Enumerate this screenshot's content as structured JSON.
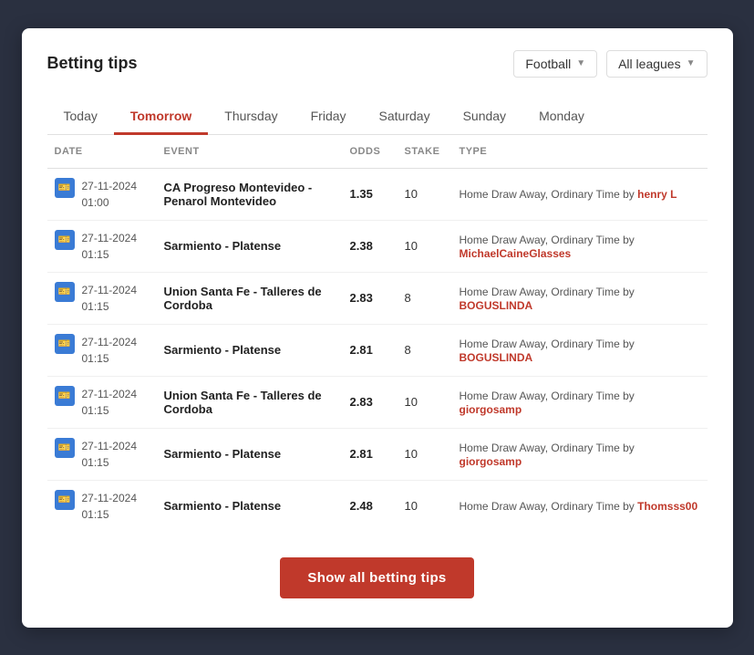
{
  "header": {
    "title": "Betting tips"
  },
  "controls": {
    "football_label": "Football",
    "leagues_label": "All leagues"
  },
  "tabs": [
    {
      "id": "today",
      "label": "Today",
      "active": false
    },
    {
      "id": "tomorrow",
      "label": "Tomorrow",
      "active": true
    },
    {
      "id": "thursday",
      "label": "Thursday",
      "active": false
    },
    {
      "id": "friday",
      "label": "Friday",
      "active": false
    },
    {
      "id": "saturday",
      "label": "Saturday",
      "active": false
    },
    {
      "id": "sunday",
      "label": "Sunday",
      "active": false
    },
    {
      "id": "monday",
      "label": "Monday",
      "active": false
    }
  ],
  "table": {
    "columns": [
      "DATE",
      "EVENT",
      "ODDS",
      "STAKE",
      "TYPE"
    ],
    "rows": [
      {
        "date": "27-11-2024",
        "time": "01:00",
        "event": "CA Progreso Montevideo - Penarol Montevideo",
        "odds": "1.35",
        "stake": "10",
        "type_text": "Home Draw Away, Ordinary Time by ",
        "user": "henry L",
        "user_color": "#c0392b"
      },
      {
        "date": "27-11-2024",
        "time": "01:15",
        "event": "Sarmiento - Platense",
        "odds": "2.38",
        "stake": "10",
        "type_text": "Home Draw Away, Ordinary Time by ",
        "user": "MichaelCaineGlasses",
        "user_color": "#c0392b"
      },
      {
        "date": "27-11-2024",
        "time": "01:15",
        "event": "Union Santa Fe - Talleres de Cordoba",
        "odds": "2.83",
        "stake": "8",
        "type_text": "Home Draw Away, Ordinary Time by ",
        "user": "BOGUSLINDA",
        "user_color": "#c0392b"
      },
      {
        "date": "27-11-2024",
        "time": "01:15",
        "event": "Sarmiento - Platense",
        "odds": "2.81",
        "stake": "8",
        "type_text": "Home Draw Away, Ordinary Time by ",
        "user": "BOGUSLINDA",
        "user_color": "#c0392b"
      },
      {
        "date": "27-11-2024",
        "time": "01:15",
        "event": "Union Santa Fe - Talleres de Cordoba",
        "odds": "2.83",
        "stake": "10",
        "type_text": "Home Draw Away, Ordinary Time by ",
        "user": "giorgosamp",
        "user_color": "#c0392b"
      },
      {
        "date": "27-11-2024",
        "time": "01:15",
        "event": "Sarmiento - Platense",
        "odds": "2.81",
        "stake": "10",
        "type_text": "Home Draw Away, Ordinary Time by ",
        "user": "giorgosamp",
        "user_color": "#c0392b"
      },
      {
        "date": "27-11-2024",
        "time": "01:15",
        "event": "Sarmiento - Platense",
        "odds": "2.48",
        "stake": "10",
        "type_text": "Home Draw Away, Ordinary Time by ",
        "user": "Thomsss00",
        "user_color": "#c0392b"
      }
    ]
  },
  "show_all_btn": "Show all betting tips"
}
